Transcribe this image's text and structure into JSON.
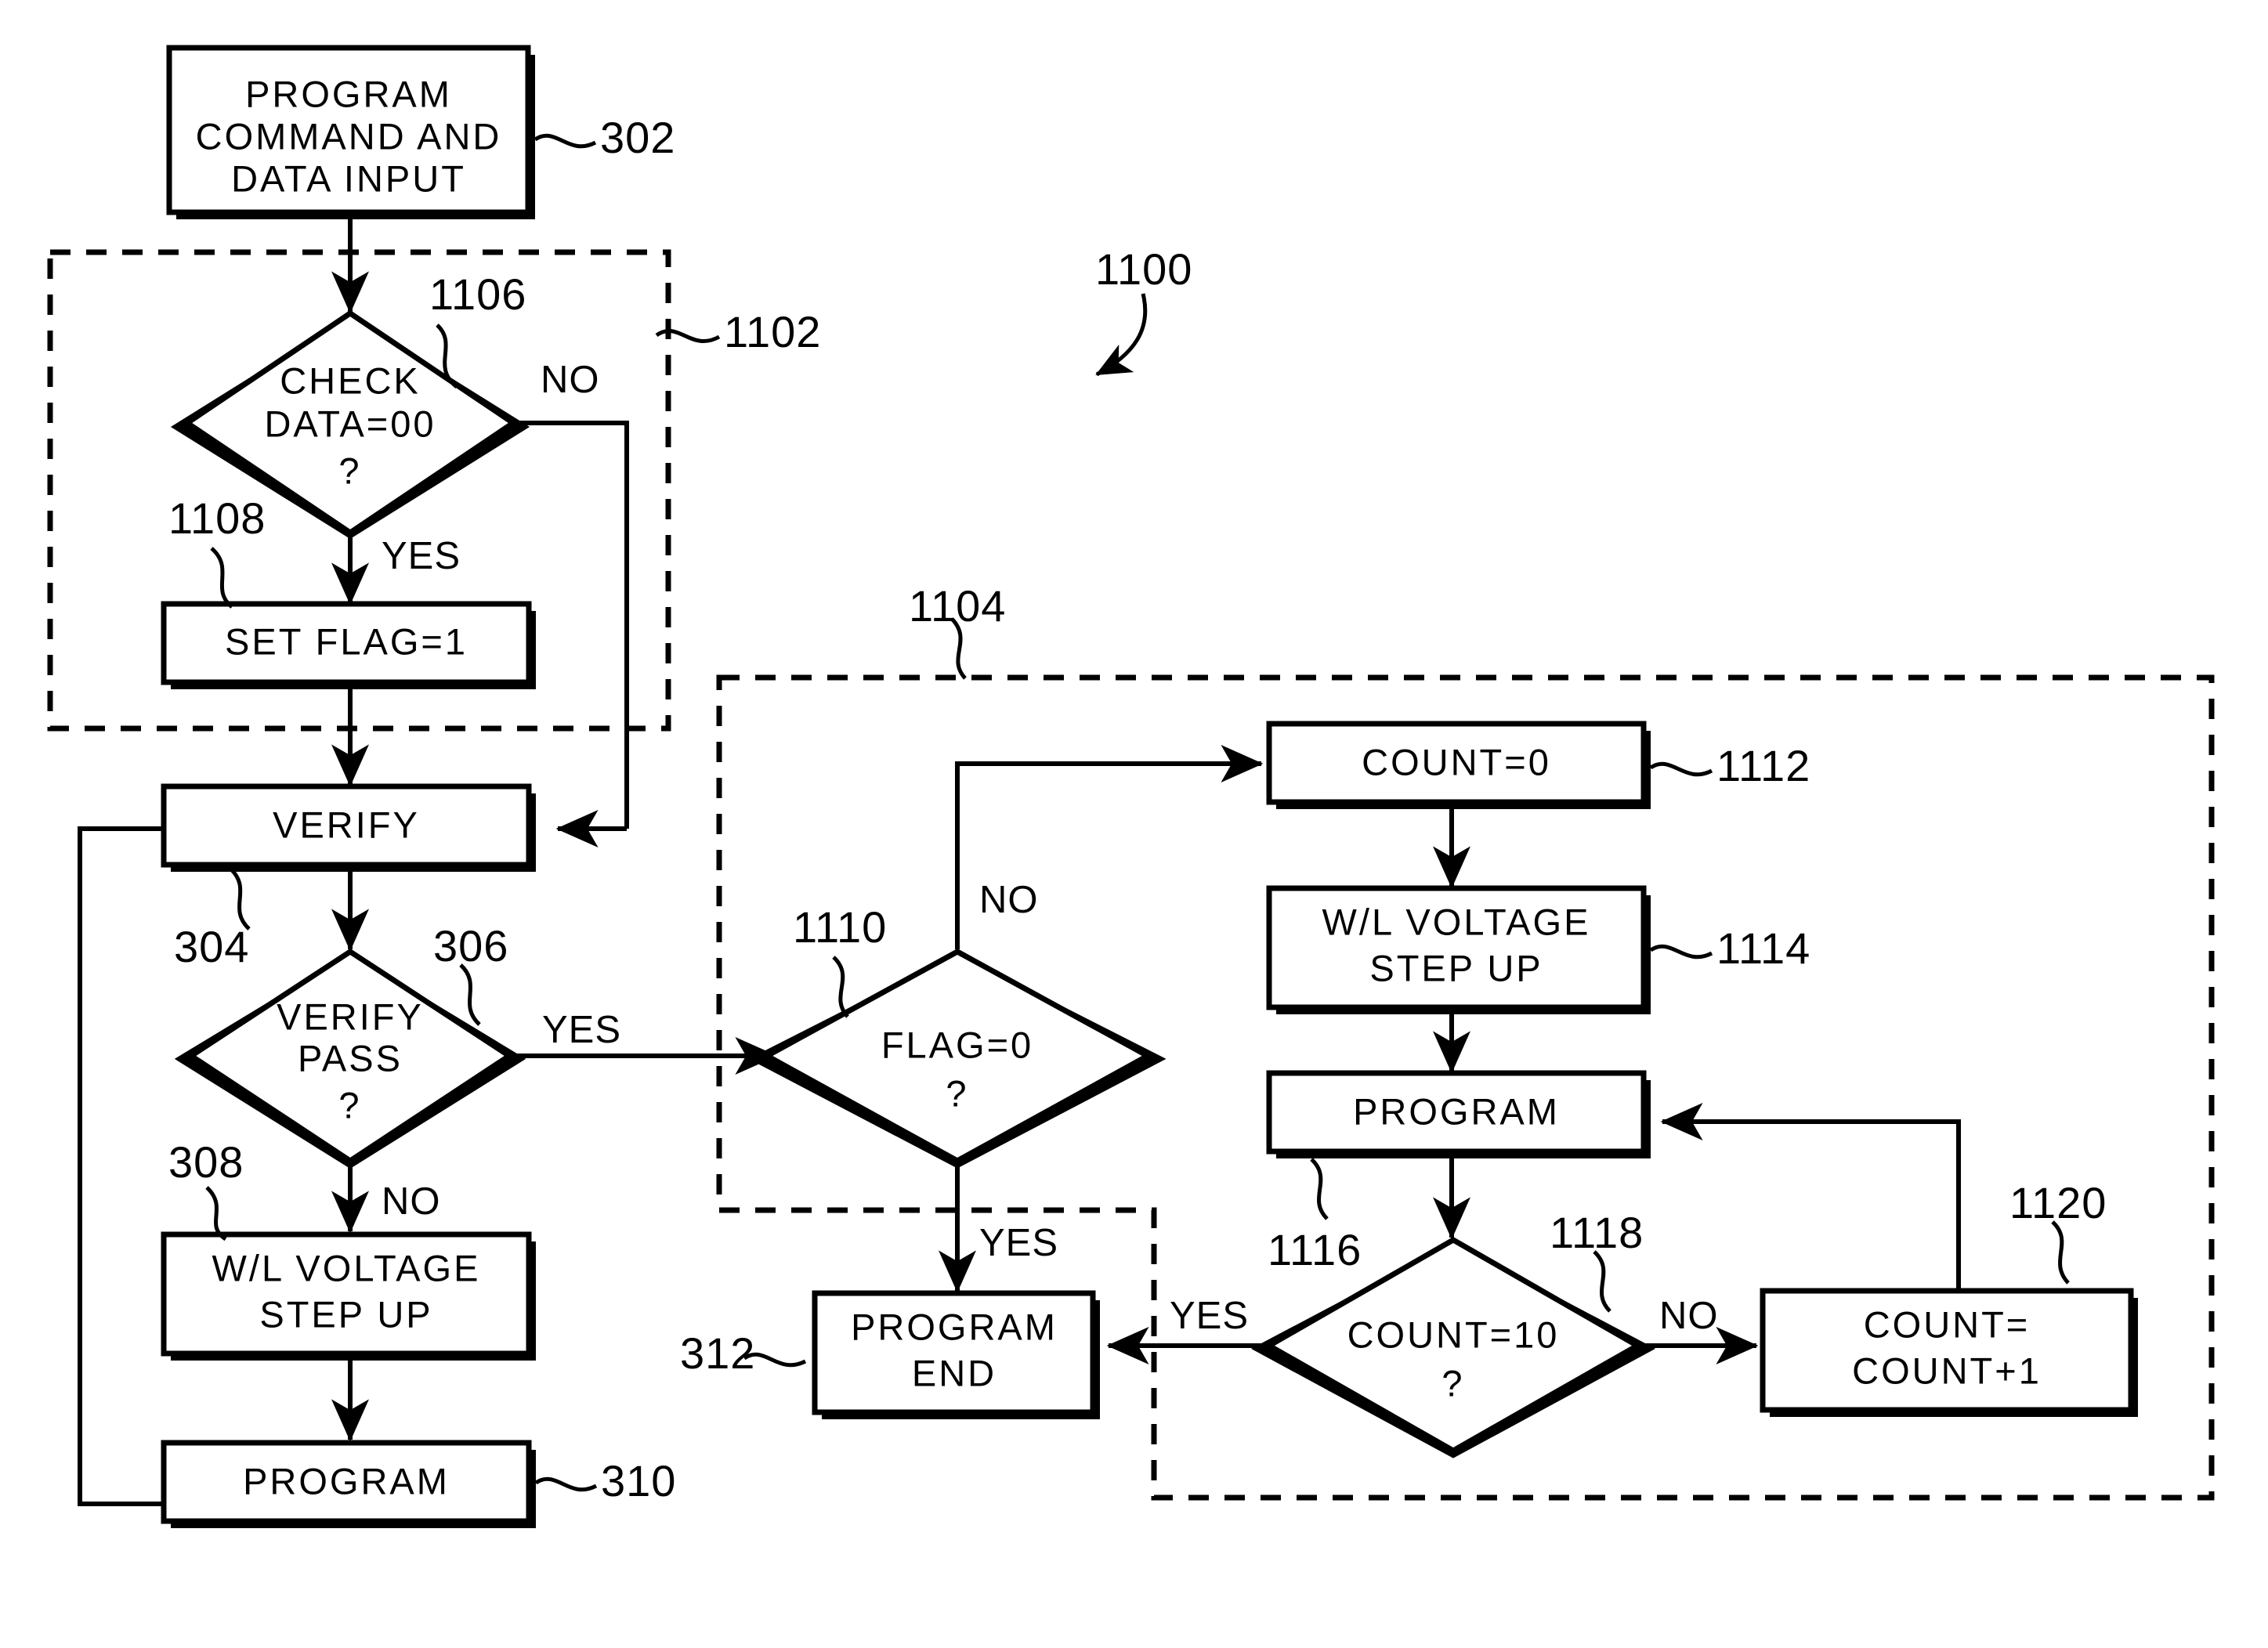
{
  "figure": {
    "label": "1100",
    "type": "flowchart"
  },
  "nodes": {
    "program_command_data_input": {
      "ref": "302",
      "lines": [
        "PROGRAM",
        "COMMAND AND",
        "DATA INPUT"
      ],
      "shape": "process"
    },
    "check_data_00": {
      "ref": "1106",
      "lines": [
        "CHECK",
        "DATA=00",
        "?"
      ],
      "shape": "decision",
      "yes": "YES",
      "no": "NO"
    },
    "set_flag_1": {
      "ref": "1108",
      "lines": [
        "SET FLAG=1"
      ],
      "shape": "process"
    },
    "verify": {
      "ref": "304",
      "lines": [
        "VERIFY"
      ],
      "shape": "process"
    },
    "verify_pass": {
      "ref": "306",
      "lines": [
        "VERIFY",
        "PASS",
        "?"
      ],
      "shape": "decision",
      "yes": "YES",
      "no": "NO"
    },
    "wl_voltage_step_up_left": {
      "ref": "308",
      "lines": [
        "W/L VOLTAGE",
        "STEP UP"
      ],
      "shape": "process"
    },
    "program_left": {
      "ref": "310",
      "lines": [
        "PROGRAM"
      ],
      "shape": "process"
    },
    "flag_0": {
      "ref": "1110",
      "lines": [
        "FLAG=0",
        "?"
      ],
      "shape": "decision",
      "yes": "YES",
      "no": "NO"
    },
    "program_end": {
      "ref": "312",
      "lines": [
        "PROGRAM",
        "END"
      ],
      "shape": "process"
    },
    "count_0": {
      "ref": "1112",
      "lines": [
        "COUNT=0"
      ],
      "shape": "process"
    },
    "wl_voltage_step_up_right": {
      "ref": "1114",
      "lines": [
        "W/L VOLTAGE",
        "STEP UP"
      ],
      "shape": "process"
    },
    "program_right": {
      "ref": "1116",
      "lines": [
        "PROGRAM"
      ],
      "shape": "process"
    },
    "count_10": {
      "ref": "1118",
      "lines": [
        "COUNT=10",
        "?"
      ],
      "shape": "decision",
      "yes": "YES",
      "no": "NO"
    },
    "count_increment": {
      "ref": "1120",
      "lines": [
        "COUNT=",
        "COUNT+1"
      ],
      "shape": "process"
    }
  },
  "groups": {
    "group_1102": {
      "ref": "1102",
      "style": "dashed"
    },
    "group_1104": {
      "ref": "1104",
      "style": "dashed"
    }
  },
  "text": {
    "t302": "302",
    "t304": "304",
    "t306": "306",
    "t308": "308",
    "t310": "310",
    "t312": "312",
    "t1100": "1100",
    "t1102": "1102",
    "t1104": "1104",
    "t1106": "1106",
    "t1108": "1108",
    "t1110": "1110",
    "t1112": "1112",
    "t1114": "1114",
    "t1116": "1116",
    "t1118": "1118",
    "t1120": "1120",
    "program_l1": "PROGRAM",
    "program_l2": "COMMAND AND",
    "program_l3": "DATA INPUT",
    "check_l1": "CHECK",
    "check_l2": "DATA=00",
    "check_l3": "?",
    "setflag": "SET FLAG=1",
    "verify": "VERIFY",
    "verifypass_l1": "VERIFY",
    "verifypass_l2": "PASS",
    "verifypass_l3": "?",
    "wl_l1": "W/L VOLTAGE",
    "wl_l2": "STEP UP",
    "program": "PROGRAM",
    "flag_l1": "FLAG=0",
    "flag_l2": "?",
    "progend_l1": "PROGRAM",
    "progend_l2": "END",
    "count0": "COUNT=0",
    "wlr_l1": "W/L VOLTAGE",
    "wlr_l2": "STEP UP",
    "programr": "PROGRAM",
    "count10_l1": "COUNT=10",
    "count10_l2": "?",
    "cinc_l1": "COUNT=",
    "cinc_l2": "COUNT+1",
    "yes1": "YES",
    "no1": "NO",
    "yes2": "YES",
    "no2": "NO",
    "no3": "NO",
    "yes3": "YES",
    "yes4": "YES",
    "no4": "NO"
  },
  "colors": {
    "stroke": "#000000",
    "fill": "#ffffff"
  }
}
